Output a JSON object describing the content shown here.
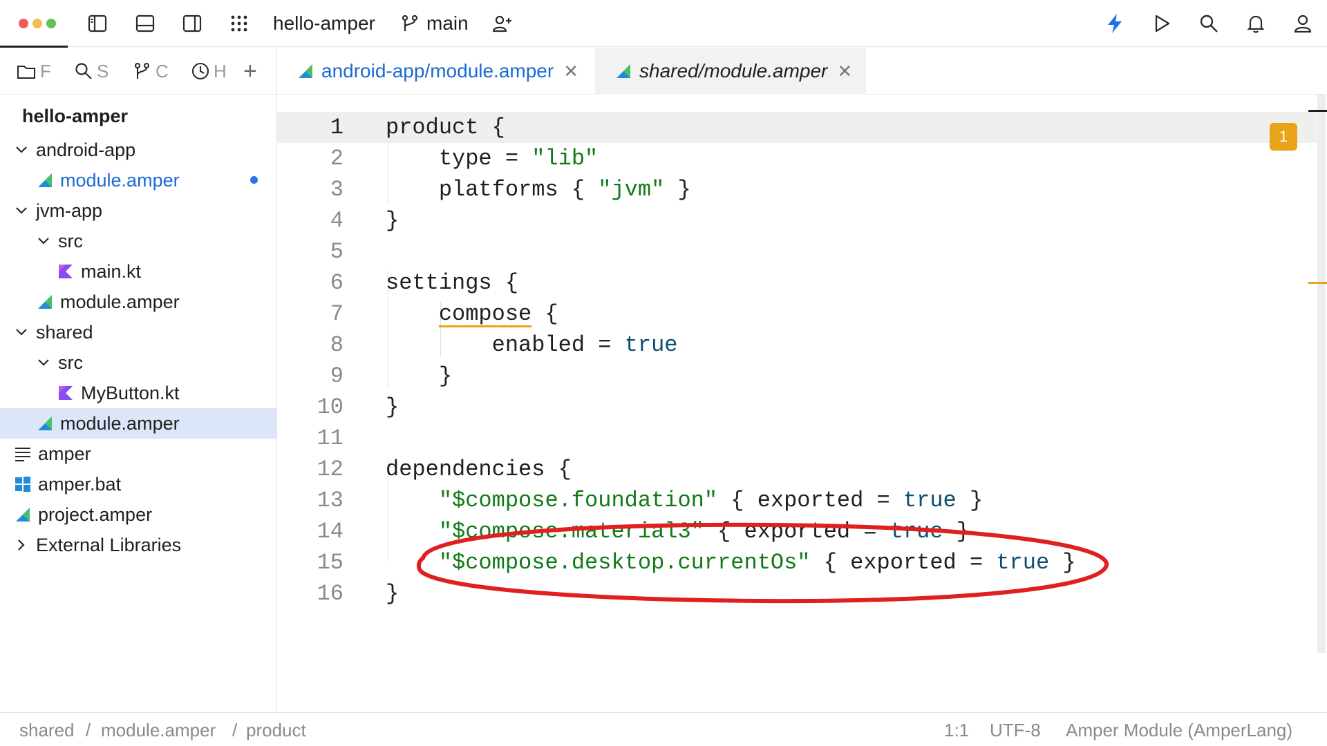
{
  "window": {
    "project_name": "hello-amper",
    "branch": "main",
    "traffic_colors": [
      "#ec5f57",
      "#f4bd4f",
      "#5fc454"
    ]
  },
  "toolbar": {
    "icons": [
      "project-view-icon",
      "bottom-panel-icon",
      "right-panel-icon",
      "apps-grid-icon",
      "branch-icon",
      "add-user-icon",
      "lightning-icon",
      "run-icon",
      "search-icon",
      "notifications-icon",
      "account-icon"
    ]
  },
  "sidebar": {
    "tabs": [
      {
        "icon": "folder-icon",
        "label": "F"
      },
      {
        "icon": "search-icon",
        "label": "S"
      },
      {
        "icon": "branch-icon",
        "label": "C"
      },
      {
        "icon": "history-icon",
        "label": "H"
      }
    ],
    "add_label": "+",
    "root": "hello-amper",
    "tree": [
      {
        "label": "android-app",
        "type": "folder",
        "expanded": true
      },
      {
        "label": "module.amper",
        "type": "amper",
        "modified": true
      },
      {
        "label": "jvm-app",
        "type": "folder",
        "expanded": true
      },
      {
        "label": "src",
        "type": "folder",
        "expanded": true
      },
      {
        "label": "main.kt",
        "type": "kotlin"
      },
      {
        "label": "module.amper",
        "type": "amper"
      },
      {
        "label": "shared",
        "type": "folder",
        "expanded": true
      },
      {
        "label": "src",
        "type": "folder",
        "expanded": true
      },
      {
        "label": "MyButton.kt",
        "type": "kotlin"
      },
      {
        "label": "module.amper",
        "type": "amper",
        "selected": true
      },
      {
        "label": "amper",
        "type": "text"
      },
      {
        "label": "amper.bat",
        "type": "windows"
      },
      {
        "label": "project.amper",
        "type": "amper"
      },
      {
        "label": "External Libraries",
        "type": "folder",
        "expanded": false
      }
    ]
  },
  "tabs": [
    {
      "label": "android-app/module.amper",
      "active": false
    },
    {
      "label": "shared/module.amper",
      "active": true
    }
  ],
  "editor": {
    "current_line": 1,
    "problems_count": "1",
    "lines": [
      "product {",
      "    type = \"lib\"",
      "    platforms { \"jvm\" }",
      "}",
      "",
      "settings {",
      "    compose {",
      "        enabled = true",
      "    }",
      "}",
      "",
      "dependencies {",
      "    \"$compose.foundation\" { exported = true }",
      "    \"$compose.material3\" { exported = true }",
      "    \"$compose.desktop.currentOs\" { exported = true }",
      "}"
    ],
    "highlighted_line": 15
  },
  "statusbar": {
    "breadcrumb": [
      "shared",
      "module.amper",
      "product"
    ],
    "separator": "/",
    "position": "1:1",
    "encoding": "UTF-8",
    "file_type": "Amper Module (AmperLang)"
  },
  "colors": {
    "accent_blue": "#1b6ad4",
    "warning": "#e8a317",
    "string": "#117a18",
    "keyword": "#0d4f6e",
    "annotation_red": "#e02020"
  }
}
